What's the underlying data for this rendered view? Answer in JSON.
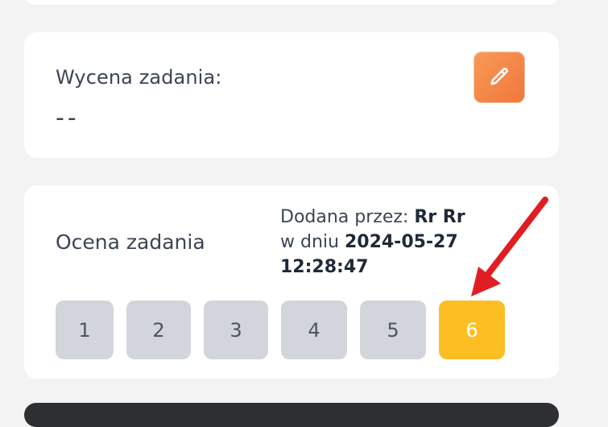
{
  "estimate": {
    "label": "Wycena zadania:",
    "value": "--",
    "edit_icon": "pencil-icon"
  },
  "rating": {
    "label": "Ocena zadania",
    "added_by_prefix": "Dodana przez:",
    "added_by_name": "Rr Rr",
    "on_day_prefix": "w dniu",
    "date": "2024-05-27",
    "time": "12:28:47",
    "options": [
      "1",
      "2",
      "3",
      "4",
      "5",
      "6"
    ],
    "selected": "6"
  },
  "colors": {
    "accent_orange": "#f0773d",
    "selected_yellow": "#fbbf24",
    "unselected_gray": "#d2d5db",
    "arrow_red": "#e11d24"
  }
}
